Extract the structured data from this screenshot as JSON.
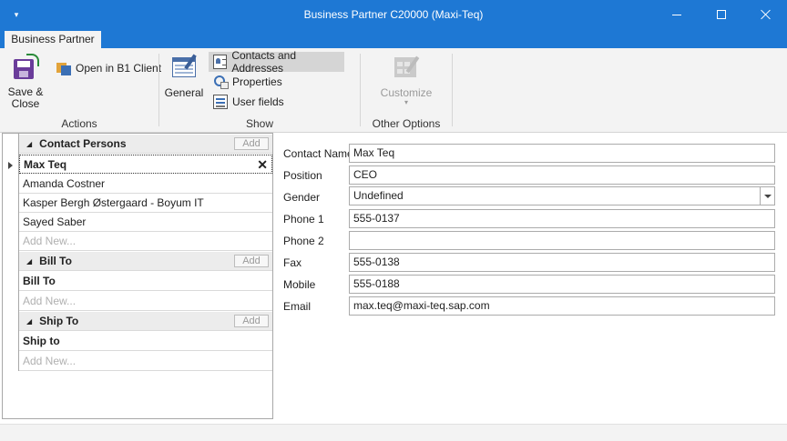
{
  "window": {
    "title": "Business Partner C20000 (Maxi-Teq)",
    "accent": "#1e78d4"
  },
  "ribbon": {
    "tab": "Business Partner",
    "groups": {
      "actions": {
        "label": "Actions",
        "save_close": "Save & Close",
        "open_b1": "Open in B1 Client"
      },
      "show": {
        "label": "Show",
        "general": "General",
        "contacts_addresses": "Contacts and Addresses",
        "properties": "Properties",
        "user_fields": "User fields"
      },
      "other": {
        "label": "Other Options",
        "customize": "Customize"
      }
    }
  },
  "tree": {
    "add_label": "Add",
    "add_new_placeholder": "Add New...",
    "contact_persons": {
      "header": "Contact Persons",
      "items": [
        "Max Teq",
        "Amanda Costner",
        "Kasper Bergh Østergaard - Boyum IT",
        "Sayed Saber"
      ]
    },
    "bill_to": {
      "header": "Bill To",
      "items": [
        "Bill To"
      ]
    },
    "ship_to": {
      "header": "Ship To",
      "items": [
        "Ship to"
      ]
    }
  },
  "form": {
    "contact_name": {
      "label": "Contact Name",
      "value": "Max Teq"
    },
    "position": {
      "label": "Position",
      "value": "CEO"
    },
    "gender": {
      "label": "Gender",
      "value": "Undefined"
    },
    "phone1": {
      "label": "Phone 1",
      "value": "555-0137"
    },
    "phone2": {
      "label": "Phone 2",
      "value": ""
    },
    "fax": {
      "label": "Fax",
      "value": "555-0138"
    },
    "mobile": {
      "label": "Mobile",
      "value": "555-0188"
    },
    "email": {
      "label": "Email",
      "value": "max.teq@maxi-teq.sap.com"
    }
  }
}
